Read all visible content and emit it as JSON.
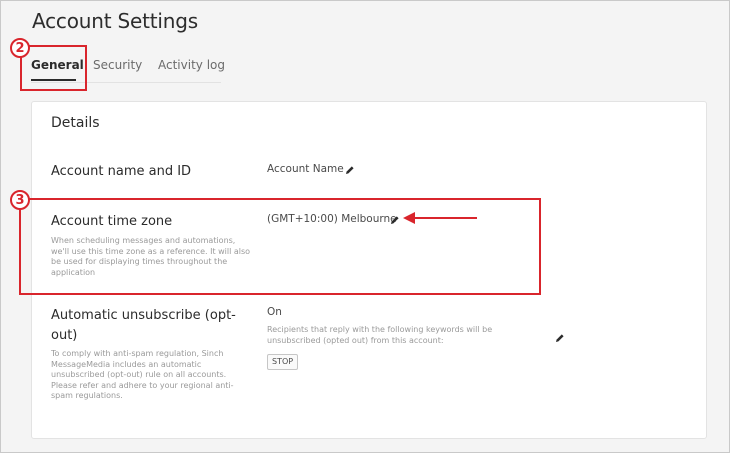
{
  "page": {
    "title": "Account Settings"
  },
  "tabs": [
    {
      "label": "General",
      "active": true
    },
    {
      "label": "Security",
      "active": false
    },
    {
      "label": "Activity log",
      "active": false
    }
  ],
  "details": {
    "title": "Details",
    "account_name_row": {
      "label": "Account name and ID",
      "value": "Account Name",
      "edit_icon": "pencil-icon"
    },
    "time_zone_row": {
      "label": "Account time zone",
      "description": "When scheduling messages and automations, we'll use this time zone as a reference. It will also be used for displaying times throughout the application",
      "value": "(GMT+10:00) Melbourne",
      "edit_icon": "pencil-icon"
    },
    "unsubscribe_row": {
      "label": "Automatic unsubscribe (opt-out)",
      "description": "To comply with anti-spam regulation, Sinch MessageMedia includes an automatic unsubscribed (opt-out) rule on all accounts. Please refer and adhere to your regional anti-spam regulations.",
      "value": "On",
      "note": "Recipients that reply with the following keywords will be unsubscribed (opted out) from this account:",
      "keywords": [
        "STOP"
      ],
      "edit_icon": "pencil-icon"
    }
  },
  "annotations": {
    "step_tabs": "2",
    "step_time_zone": "3",
    "color": "#d9252c"
  },
  "colors": {
    "background": "#f4f4f4",
    "card": "#ffffff",
    "annotation_red": "#d9252c"
  }
}
